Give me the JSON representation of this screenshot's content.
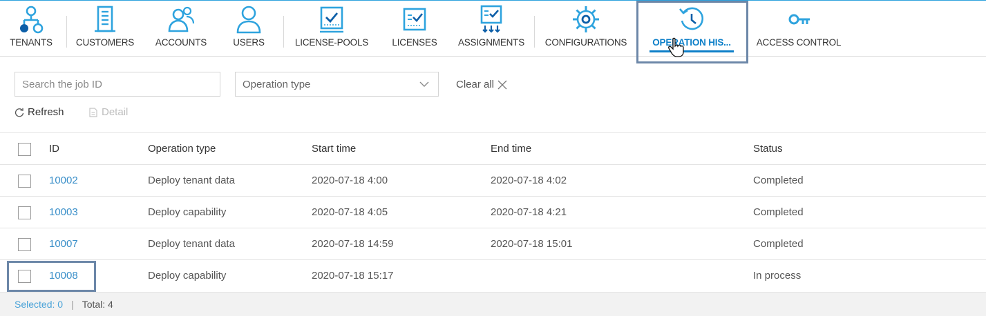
{
  "nav": {
    "items": [
      {
        "id": "tenants",
        "label": "TENANTS",
        "icon": "tenants-icon"
      },
      {
        "id": "customers",
        "label": "CUSTOMERS",
        "icon": "building-icon"
      },
      {
        "id": "accounts",
        "label": "ACCOUNTS",
        "icon": "users-group-icon"
      },
      {
        "id": "users",
        "label": "USERS",
        "icon": "user-icon"
      },
      {
        "id": "license-pools",
        "label": "LICENSE-POOLS",
        "icon": "license-pool-icon"
      },
      {
        "id": "licenses",
        "label": "LICENSES",
        "icon": "license-icon"
      },
      {
        "id": "assignments",
        "label": "ASSIGNMENTS",
        "icon": "assignment-icon"
      },
      {
        "id": "configurations",
        "label": "CONFIGURATIONS",
        "icon": "gear-icon"
      },
      {
        "id": "operation-history",
        "label": "OPERATION HIS...",
        "icon": "history-icon",
        "active": true
      },
      {
        "id": "access-control",
        "label": "ACCESS CONTROL",
        "icon": "key-icon"
      }
    ],
    "accent_color": "#0d7fc8",
    "icon_color": "#2ea3de"
  },
  "filters": {
    "search_placeholder": "Search the job ID",
    "operation_type_placeholder": "Operation type",
    "clear_all_label": "Clear all"
  },
  "toolbar": {
    "refresh_label": "Refresh",
    "detail_label": "Detail"
  },
  "table": {
    "columns": {
      "id": "ID",
      "operation_type": "Operation type",
      "start_time": "Start time",
      "end_time": "End time",
      "status": "Status"
    },
    "rows": [
      {
        "id": "10002",
        "operation_type": "Deploy tenant data",
        "start_time": "2020-07-18 4:00",
        "end_time": "2020-07-18 4:02",
        "status": "Completed"
      },
      {
        "id": "10003",
        "operation_type": "Deploy capability",
        "start_time": "2020-07-18 4:05",
        "end_time": "2020-07-18 4:21",
        "status": "Completed"
      },
      {
        "id": "10007",
        "operation_type": "Deploy tenant data",
        "start_time": "2020-07-18 14:59",
        "end_time": "2020-07-18 15:01",
        "status": "Completed"
      },
      {
        "id": "10008",
        "operation_type": "Deploy capability",
        "start_time": "2020-07-18 15:17",
        "end_time": "",
        "status": "In process"
      }
    ]
  },
  "footer": {
    "selected_text": "Selected: 0",
    "separator": "|",
    "total_text": "Total: 4"
  }
}
